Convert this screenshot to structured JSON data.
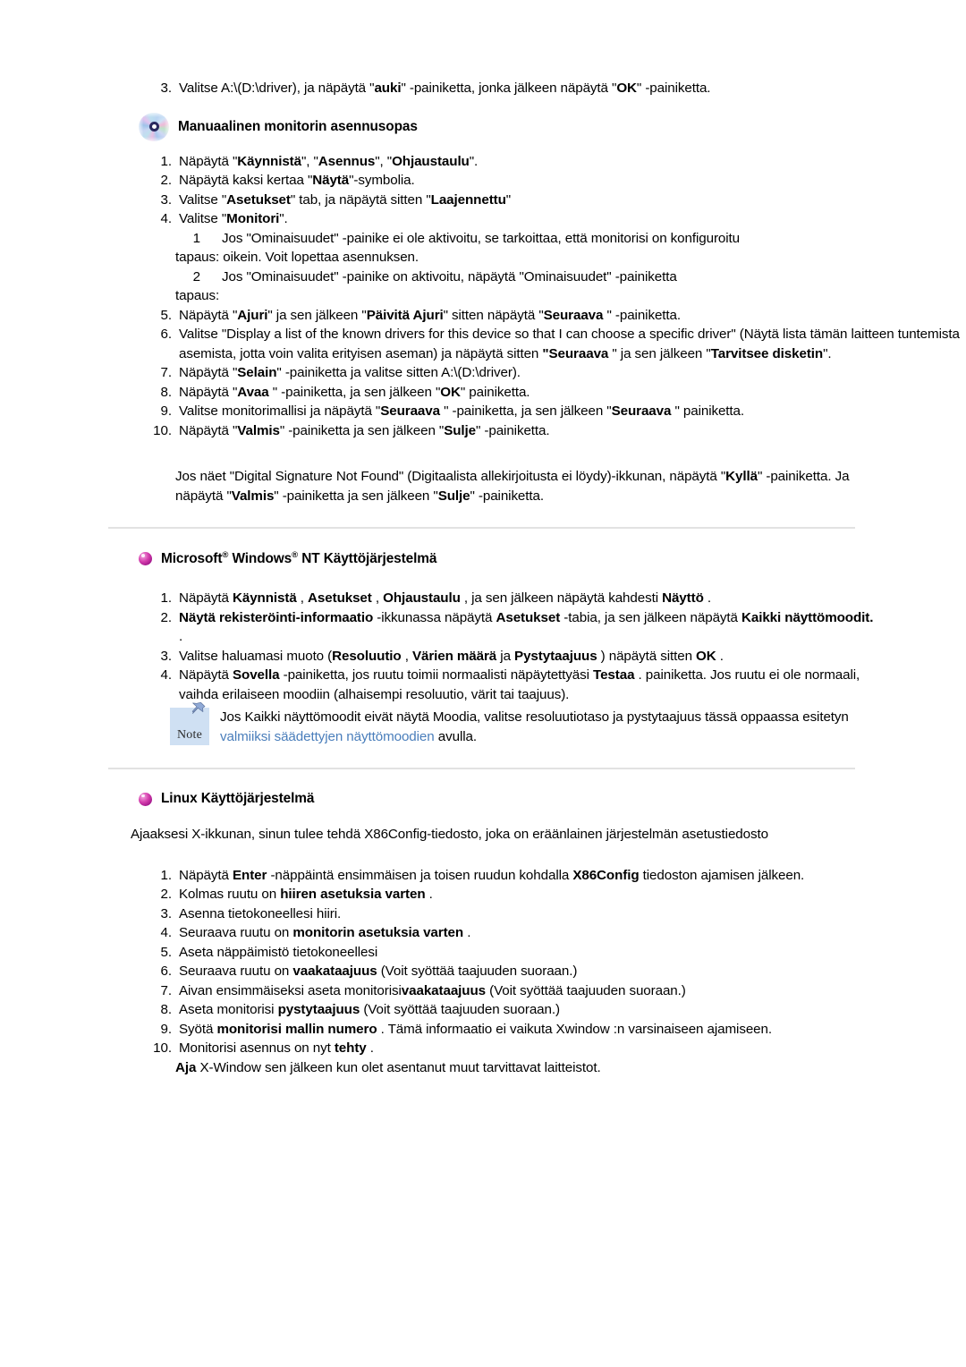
{
  "document": {
    "language": "fi",
    "colors": {
      "text": "#000000",
      "link": "#4a7ebb",
      "divider": "#e2e2e2",
      "bullet": "#c21fa0",
      "note_box": "#cfe0f3"
    }
  },
  "top_step": {
    "number": "3.",
    "parts": [
      {
        "t": "Valitse A:\\(D:\\driver), ja näpäytä \"",
        "b": false
      },
      {
        "t": "auki",
        "b": true
      },
      {
        "t": "\" -painiketta, jonka jälkeen näpäytä \"",
        "b": false
      },
      {
        "t": "OK",
        "b": true
      },
      {
        "t": "\" -painiketta.",
        "b": false
      }
    ]
  },
  "manual_section": {
    "icon": "cd-disc-icon",
    "heading": "Manuaalinen monitorin asennusopas",
    "steps": [
      {
        "number": "1.",
        "parts": [
          {
            "t": "Näpäytä \"",
            "b": false
          },
          {
            "t": "Käynnistä",
            "b": true
          },
          {
            "t": "\", \"",
            "b": false
          },
          {
            "t": "Asennus",
            "b": true
          },
          {
            "t": "\", \"",
            "b": false
          },
          {
            "t": "Ohjaustaulu",
            "b": true
          },
          {
            "t": "\".",
            "b": false
          }
        ]
      },
      {
        "number": "2.",
        "parts": [
          {
            "t": "Näpäytä kaksi kertaa \"",
            "b": false
          },
          {
            "t": "Näytä",
            "b": true
          },
          {
            "t": "\"-symbolia.",
            "b": false
          }
        ]
      },
      {
        "number": "3.",
        "parts": [
          {
            "t": "Valitse \"",
            "b": false
          },
          {
            "t": "Asetukset",
            "b": true
          },
          {
            "t": "\" tab, ja näpäytä sitten \"",
            "b": false
          },
          {
            "t": "Laajennettu",
            "b": true
          },
          {
            "t": "\"",
            "b": false
          }
        ]
      },
      {
        "number": "4.",
        "parts": [
          {
            "t": "Valitse \"",
            "b": false
          },
          {
            "t": "Monitori",
            "b": true
          },
          {
            "t": "\".",
            "b": false
          }
        ]
      }
    ],
    "sub_cases": [
      {
        "number": "1",
        "text": "Jos \"Ominaisuudet\" -painike ei ole aktivoitu, se tarkoittaa, että monitorisi on konfiguroitu",
        "label": "tapaus: oikein. Voit lopettaa asennuksen."
      },
      {
        "number": "2",
        "text": "Jos \"Ominaisuudet\" -painike on aktivoitu, näpäytä \"Ominaisuudet\" -painiketta",
        "label": "tapaus:"
      }
    ],
    "steps_cont": [
      {
        "number": "5.",
        "parts": [
          {
            "t": "Näpäytä \"",
            "b": false
          },
          {
            "t": "Ajuri",
            "b": true
          },
          {
            "t": "\" ja sen jälkeen \"",
            "b": false
          },
          {
            "t": "Päivitä Ajuri",
            "b": true
          },
          {
            "t": "\" sitten näpäytä \"",
            "b": false
          },
          {
            "t": "Seuraava ",
            "b": true
          },
          {
            "t": "\" -painiketta.",
            "b": false
          }
        ]
      },
      {
        "number": "6.",
        "parts": [
          {
            "t": "Valitse \"Display a list of the known drivers for this device so that I can choose a specific driver\" (Näytä lista tämän laitteen tuntemista asemista, jotta voin valita erityisen aseman) ja näpäytä sitten ",
            "b": false
          },
          {
            "t": "\"Seuraava ",
            "b": true
          },
          {
            "t": "\" ja sen jälkeen \"",
            "b": false
          },
          {
            "t": "Tarvitsee disketin",
            "b": true
          },
          {
            "t": "\".",
            "b": false
          }
        ]
      },
      {
        "number": "7.",
        "parts": [
          {
            "t": "Näpäytä \"",
            "b": false
          },
          {
            "t": "Selain",
            "b": true
          },
          {
            "t": "\" -painiketta ja valitse sitten A:\\(D:\\driver).",
            "b": false
          }
        ]
      },
      {
        "number": "8.",
        "parts": [
          {
            "t": "Näpäytä \"",
            "b": false
          },
          {
            "t": "Avaa ",
            "b": true
          },
          {
            "t": "\" -painiketta, ja sen jälkeen \"",
            "b": false
          },
          {
            "t": "OK",
            "b": true
          },
          {
            "t": "\" painiketta.",
            "b": false
          }
        ]
      },
      {
        "number": "9.",
        "parts": [
          {
            "t": "Valitse monitorimallisi ja näpäytä \"",
            "b": false
          },
          {
            "t": "Seuraava ",
            "b": true
          },
          {
            "t": "\" -painiketta, ja sen jälkeen \"",
            "b": false
          },
          {
            "t": "Seuraava ",
            "b": true
          },
          {
            "t": "\" painiketta.",
            "b": false
          }
        ]
      },
      {
        "number": "10.",
        "parts": [
          {
            "t": "Näpäytä \"",
            "b": false
          },
          {
            "t": "Valmis",
            "b": true
          },
          {
            "t": "\" -painiketta ja sen jälkeen \"",
            "b": false
          },
          {
            "t": "Sulje",
            "b": true
          },
          {
            "t": "\" -painiketta.",
            "b": false
          }
        ]
      }
    ],
    "closing_paragraph": [
      {
        "t": "Jos näet \"Digital Signature Not Found\" (Digitaalista allekirjoitusta ei löydy)-ikkunan, näpäytä \"",
        "b": false
      },
      {
        "t": "Kyllä",
        "b": true
      },
      {
        "t": "\" -painiketta. Ja näpäytä \"",
        "b": false
      },
      {
        "t": "Valmis",
        "b": true
      },
      {
        "t": "\" -painiketta ja sen jälkeen \"",
        "b": false
      },
      {
        "t": "Sulje",
        "b": true
      },
      {
        "t": "\" -painiketta.",
        "b": false
      }
    ]
  },
  "nt_section": {
    "icon": "magenta-sphere-bullet",
    "heading_parts": [
      {
        "t": "Microsoft",
        "b": true
      },
      {
        "t": "®",
        "sup": true
      },
      {
        "t": " Windows",
        "b": true
      },
      {
        "t": "®",
        "sup": true
      },
      {
        "t": " NT Käyttöjärjestelmä",
        "b": true
      }
    ],
    "heading_plain": "Microsoft® Windows® NT Käyttöjärjestelmä",
    "steps": [
      {
        "number": "1.",
        "parts": [
          {
            "t": "Näpäytä ",
            "b": false
          },
          {
            "t": "Käynnistä",
            "b": true
          },
          {
            "t": " , ",
            "b": false
          },
          {
            "t": "Asetukset",
            "b": true
          },
          {
            "t": " , ",
            "b": false
          },
          {
            "t": "Ohjaustaulu",
            "b": true
          },
          {
            "t": " , ja sen jälkeen näpäytä kahdesti ",
            "b": false
          },
          {
            "t": "Näyttö",
            "b": true
          },
          {
            "t": " .",
            "b": false
          }
        ]
      },
      {
        "number": "2.",
        "parts": [
          {
            "t": "Näytä rekisteröinti-informaatio",
            "b": true
          },
          {
            "t": " -ikkunassa näpäytä ",
            "b": false
          },
          {
            "t": "Asetukset",
            "b": true
          },
          {
            "t": " -tabia, ja sen jälkeen näpäytä ",
            "b": false
          },
          {
            "t": "Kaikki näyttömoodit.",
            "b": true
          },
          {
            "t": " .",
            "b": false
          }
        ]
      },
      {
        "number": "3.",
        "parts": [
          {
            "t": "Valitse haluamasi muoto (",
            "b": false
          },
          {
            "t": "Resoluutio",
            "b": true
          },
          {
            "t": " , ",
            "b": false
          },
          {
            "t": "Värien määrä",
            "b": true
          },
          {
            "t": " ja ",
            "b": false
          },
          {
            "t": "Pystytaajuus",
            "b": true
          },
          {
            "t": " ) näpäytä sitten ",
            "b": false
          },
          {
            "t": "OK",
            "b": true
          },
          {
            "t": " .",
            "b": false
          }
        ]
      },
      {
        "number": "4.",
        "parts": [
          {
            "t": "Näpäytä ",
            "b": false
          },
          {
            "t": "Sovella",
            "b": true
          },
          {
            "t": " -painiketta, jos ruutu toimii normaalisti näpäytettyäsi ",
            "b": false
          },
          {
            "t": "Testaa",
            "b": true
          },
          {
            "t": " . painiketta. Jos ruutu ei ole normaali, vaihda erilaiseen moodiin (alhaisempi resoluutio, värit tai taajuus).",
            "b": false
          }
        ]
      }
    ],
    "note": {
      "icon": "note-pin-icon",
      "label": "Note",
      "parts": [
        {
          "t": "Jos Kaikki näyttömoodit eivät näytä Moodia, valitse resoluutiotaso ja pystytaajuus tässä oppaassa esitetyn ",
          "b": false,
          "link": false
        },
        {
          "t": "valmiiksi säädettyjen näyttömoodien",
          "b": false,
          "link": true
        },
        {
          "t": " avulla.",
          "b": false,
          "link": false
        }
      ]
    }
  },
  "linux_section": {
    "icon": "magenta-sphere-bullet",
    "heading": "Linux Käyttöjärjestelmä",
    "intro": "Ajaaksesi X-ikkunan, sinun tulee tehdä X86Config-tiedosto, joka on eräänlainen järjestelmän asetustiedosto",
    "steps": [
      {
        "number": "1.",
        "parts": [
          {
            "t": "Näpäytä ",
            "b": false
          },
          {
            "t": "Enter",
            "b": true
          },
          {
            "t": " -näppäintä ensimmäisen ja toisen ruudun kohdalla ",
            "b": false
          },
          {
            "t": "X86Config",
            "b": true
          },
          {
            "t": " tiedoston ajamisen jälkeen.",
            "b": false
          }
        ]
      },
      {
        "number": "2.",
        "parts": [
          {
            "t": "Kolmas ruutu on ",
            "b": false
          },
          {
            "t": "hiiren asetuksia varten",
            "b": true
          },
          {
            "t": " .",
            "b": false
          }
        ]
      },
      {
        "number": "3.",
        "parts": [
          {
            "t": "Asenna tietokoneellesi hiiri.",
            "b": false
          }
        ]
      },
      {
        "number": "4.",
        "parts": [
          {
            "t": "Seuraava ruutu on ",
            "b": false
          },
          {
            "t": "monitorin asetuksia varten",
            "b": true
          },
          {
            "t": " .",
            "b": false
          }
        ]
      },
      {
        "number": "5.",
        "parts": [
          {
            "t": "Aseta näppäimistö tietokoneellesi",
            "b": false
          }
        ]
      },
      {
        "number": "6.",
        "parts": [
          {
            "t": "Seuraava ruutu on ",
            "b": false
          },
          {
            "t": "vaakataajuus",
            "b": true
          },
          {
            "t": " (Voit syöttää taajuuden suoraan.)",
            "b": false
          }
        ]
      },
      {
        "number": "7.",
        "parts": [
          {
            "t": "Aivan ensimmäiseksi aseta monitorisi",
            "b": false
          },
          {
            "t": "vaakataajuus",
            "b": true
          },
          {
            "t": " (Voit syöttää taajuuden suoraan.)",
            "b": false
          }
        ]
      },
      {
        "number": "8.",
        "parts": [
          {
            "t": "Aseta monitorisi ",
            "b": false
          },
          {
            "t": "pystytaajuus",
            "b": true
          },
          {
            "t": " (Voit syöttää taajuuden suoraan.)",
            "b": false
          }
        ]
      },
      {
        "number": "9.",
        "parts": [
          {
            "t": "Syötä ",
            "b": false
          },
          {
            "t": "monitorisi mallin numero",
            "b": true
          },
          {
            "t": " . Tämä informaatio ei vaikuta Xwindow :n varsinaiseen ajamiseen.",
            "b": false
          }
        ]
      },
      {
        "number": "10.",
        "parts": [
          {
            "t": "Monitorisi asennus on nyt ",
            "b": false
          },
          {
            "t": "tehty",
            "b": true
          },
          {
            "t": " .",
            "b": false
          }
        ]
      }
    ],
    "final_line": [
      {
        "t": "Aja",
        "b": true
      },
      {
        "t": " X-Window sen jälkeen kun olet asentanut muut tarvittavat laitteistot.",
        "b": false
      }
    ]
  }
}
